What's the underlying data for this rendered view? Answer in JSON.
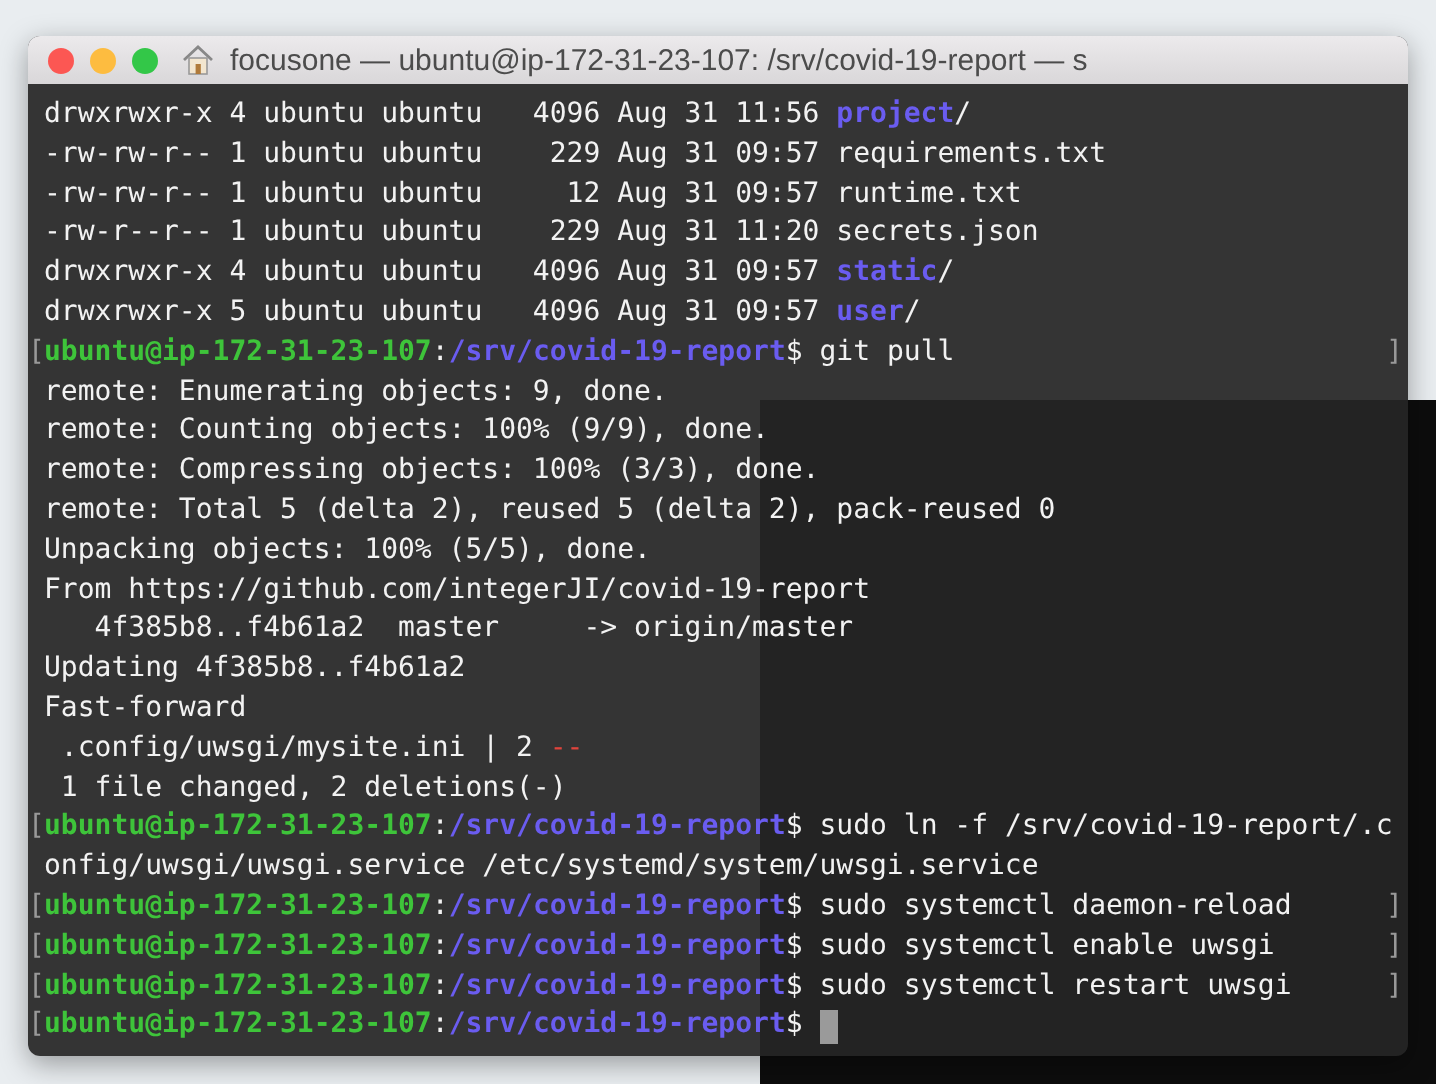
{
  "window": {
    "title": "focusone — ubuntu@ip-172-31-23-107: /srv/covid-19-report — s"
  },
  "lines": [
    {
      "segments": [
        {
          "kind": "plain",
          "text": "drwxrwxr-x 4 ubuntu ubuntu   4096 Aug 31 11:56 "
        },
        {
          "kind": "dir",
          "text": "project"
        },
        {
          "kind": "plain",
          "text": "/"
        }
      ]
    },
    {
      "segments": [
        {
          "kind": "plain",
          "text": "-rw-rw-r-- 1 ubuntu ubuntu    229 Aug 31 09:57 requirements.txt"
        }
      ]
    },
    {
      "segments": [
        {
          "kind": "plain",
          "text": "-rw-rw-r-- 1 ubuntu ubuntu     12 Aug 31 09:57 runtime.txt"
        }
      ]
    },
    {
      "segments": [
        {
          "kind": "plain",
          "text": "-rw-r--r-- 1 ubuntu ubuntu    229 Aug 31 11:20 secrets.json"
        }
      ]
    },
    {
      "segments": [
        {
          "kind": "plain",
          "text": "drwxrwxr-x 4 ubuntu ubuntu   4096 Aug 31 09:57 "
        },
        {
          "kind": "dir",
          "text": "static"
        },
        {
          "kind": "plain",
          "text": "/"
        }
      ]
    },
    {
      "segments": [
        {
          "kind": "plain",
          "text": "drwxrwxr-x 5 ubuntu ubuntu   4096 Aug 31 09:57 "
        },
        {
          "kind": "dir",
          "text": "user"
        },
        {
          "kind": "plain",
          "text": "/"
        }
      ]
    },
    {
      "segments": [
        {
          "kind": "bracket_left",
          "text": "["
        },
        {
          "kind": "user",
          "text": "ubuntu@ip-172-31-23-107"
        },
        {
          "kind": "plain",
          "text": ":"
        },
        {
          "kind": "path",
          "text": "/srv/covid-19-report"
        },
        {
          "kind": "plain",
          "text": "$ git pull"
        },
        {
          "kind": "bracket_right",
          "text": "]"
        }
      ]
    },
    {
      "segments": [
        {
          "kind": "plain",
          "text": "remote: Enumerating objects: 9, done."
        }
      ]
    },
    {
      "segments": [
        {
          "kind": "plain",
          "text": "remote: Counting objects: 100% (9/9), done."
        }
      ]
    },
    {
      "segments": [
        {
          "kind": "plain",
          "text": "remote: Compressing objects: 100% (3/3), done."
        }
      ]
    },
    {
      "segments": [
        {
          "kind": "plain",
          "text": "remote: Total 5 (delta 2), reused 5 (delta 2), pack-reused 0"
        }
      ]
    },
    {
      "segments": [
        {
          "kind": "plain",
          "text": "Unpacking objects: 100% (5/5), done."
        }
      ]
    },
    {
      "segments": [
        {
          "kind": "plain",
          "text": "From https://github.com/integerJI/covid-19-report"
        }
      ]
    },
    {
      "segments": [
        {
          "kind": "plain",
          "text": "   4f385b8..f4b61a2  master     -> origin/master"
        }
      ]
    },
    {
      "segments": [
        {
          "kind": "plain",
          "text": "Updating 4f385b8..f4b61a2"
        }
      ]
    },
    {
      "segments": [
        {
          "kind": "plain",
          "text": "Fast-forward"
        }
      ]
    },
    {
      "segments": [
        {
          "kind": "plain",
          "text": " .config/uwsgi/mysite.ini | 2 "
        },
        {
          "kind": "deleted",
          "text": "--"
        }
      ]
    },
    {
      "segments": [
        {
          "kind": "plain",
          "text": " 1 file changed, 2 deletions(-)"
        }
      ]
    },
    {
      "segments": [
        {
          "kind": "bracket_left",
          "text": "["
        },
        {
          "kind": "user",
          "text": "ubuntu@ip-172-31-23-107"
        },
        {
          "kind": "plain",
          "text": ":"
        },
        {
          "kind": "path",
          "text": "/srv/covid-19-report"
        },
        {
          "kind": "plain",
          "text": "$ sudo ln -f /srv/covid-19-report/.c"
        }
      ]
    },
    {
      "segments": [
        {
          "kind": "plain",
          "text": "onfig/uwsgi/uwsgi.service /etc/systemd/system/uwsgi.service"
        }
      ]
    },
    {
      "segments": [
        {
          "kind": "bracket_left",
          "text": "["
        },
        {
          "kind": "user",
          "text": "ubuntu@ip-172-31-23-107"
        },
        {
          "kind": "plain",
          "text": ":"
        },
        {
          "kind": "path",
          "text": "/srv/covid-19-report"
        },
        {
          "kind": "plain",
          "text": "$ sudo systemctl daemon-reload"
        },
        {
          "kind": "bracket_right",
          "text": "]"
        }
      ]
    },
    {
      "segments": [
        {
          "kind": "bracket_left",
          "text": "["
        },
        {
          "kind": "user",
          "text": "ubuntu@ip-172-31-23-107"
        },
        {
          "kind": "plain",
          "text": ":"
        },
        {
          "kind": "path",
          "text": "/srv/covid-19-report"
        },
        {
          "kind": "plain",
          "text": "$ sudo systemctl enable uwsgi"
        },
        {
          "kind": "bracket_right",
          "text": "]"
        }
      ]
    },
    {
      "segments": [
        {
          "kind": "bracket_left",
          "text": "["
        },
        {
          "kind": "user",
          "text": "ubuntu@ip-172-31-23-107"
        },
        {
          "kind": "plain",
          "text": ":"
        },
        {
          "kind": "path",
          "text": "/srv/covid-19-report"
        },
        {
          "kind": "plain",
          "text": "$ sudo systemctl restart uwsgi"
        },
        {
          "kind": "bracket_right",
          "text": "]"
        }
      ]
    },
    {
      "cursor": true,
      "segments": [
        {
          "kind": "bracket_left",
          "text": "["
        },
        {
          "kind": "user",
          "text": "ubuntu@ip-172-31-23-107"
        },
        {
          "kind": "plain",
          "text": ":"
        },
        {
          "kind": "path",
          "text": "/srv/covid-19-report"
        },
        {
          "kind": "plain",
          "text": "$ "
        }
      ]
    }
  ]
}
